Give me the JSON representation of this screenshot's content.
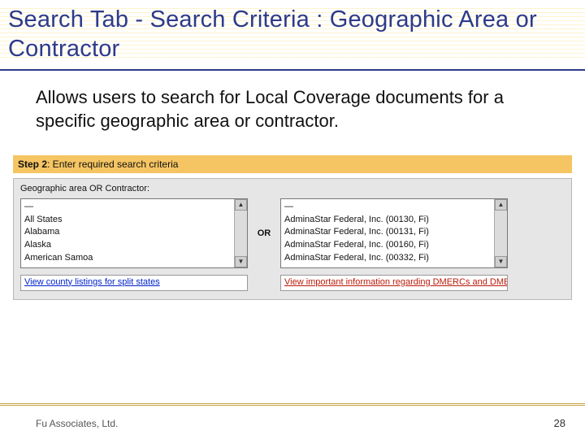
{
  "title": "Search Tab - Search Criteria : Geographic Area or Contractor",
  "body": "Allows users to search for Local Coverage documents for a specific geographic area or contractor.",
  "step": {
    "label_bold": "Step 2",
    "label_rest": ": Enter required search criteria"
  },
  "form": {
    "group_label": "Geographic area OR Contractor:",
    "or_label": "OR",
    "states": [
      "—",
      "All States",
      "Alabama",
      "Alaska",
      "American Samoa"
    ],
    "contractors": [
      "—",
      "AdminaStar Federal, Inc. (00130, Fi)",
      "AdminaStar Federal, Inc. (00131, Fi)",
      "AdminaStar Federal, Inc. (00160, Fi)",
      "AdminaStar Federal, Inc. (00332, Fi)"
    ],
    "link_left": "View county listings for split states",
    "link_right": "View important information regarding DMERCs and DME PSCs"
  },
  "footer": {
    "company": "Fu Associates, Ltd.",
    "page": "28"
  }
}
